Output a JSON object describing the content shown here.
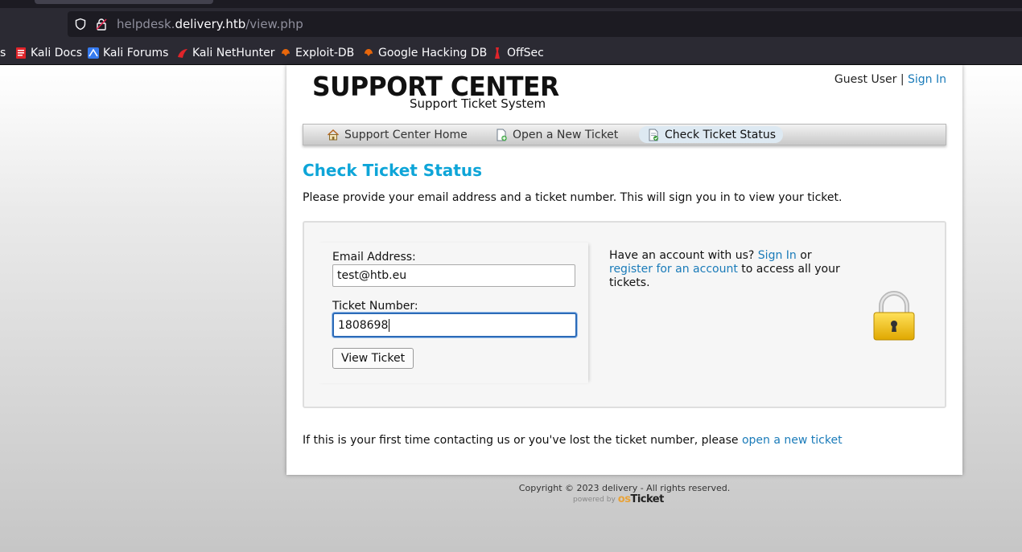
{
  "browser": {
    "url_host_prefix": "helpdesk.",
    "url_host": "delivery.htb",
    "url_path": "/view.php",
    "bookmarks": [
      {
        "label": "s",
        "icon": "folder-icon"
      },
      {
        "label": "Kali Docs",
        "icon": "kali-docs-icon"
      },
      {
        "label": "Kali Forums",
        "icon": "kali-forums-icon"
      },
      {
        "label": "Kali NetHunter",
        "icon": "kali-nethunter-icon"
      },
      {
        "label": "Exploit-DB",
        "icon": "exploit-db-icon"
      },
      {
        "label": "Google Hacking DB",
        "icon": "ghdb-icon"
      },
      {
        "label": "OffSec",
        "icon": "offsec-icon"
      }
    ]
  },
  "header": {
    "title": "SUPPORT CENTER",
    "subtitle": "Support Ticket System",
    "user_label": "Guest User",
    "separator": "|",
    "signin_label": "Sign In"
  },
  "nav": {
    "items": [
      {
        "label": "Support Center Home",
        "icon": "home-icon"
      },
      {
        "label": "Open a New Ticket",
        "icon": "new-ticket-icon"
      },
      {
        "label": "Check Ticket Status",
        "icon": "ticket-status-icon",
        "active": true
      }
    ]
  },
  "main": {
    "heading": "Check Ticket Status",
    "intro": "Please provide your email address and a ticket number. This will sign you in to view your ticket.",
    "form": {
      "email_label": "Email Address:",
      "email_value": "test@htb.eu",
      "ticket_label": "Ticket Number:",
      "ticket_value": "1808698",
      "submit_label": "View Ticket"
    },
    "account": {
      "prefix": "Have an account with us?",
      "signin_link": "Sign In",
      "or": "or",
      "register_link": "register for an account",
      "suffix": "to access all your tickets."
    },
    "footer_note": "If this is your first time contacting us or you've lost the ticket number, please",
    "footer_link": "open a new ticket"
  },
  "footer": {
    "copyright": "Copyright © 2023 delivery - All rights reserved.",
    "powered_by": "powered by",
    "brand_os": "os",
    "brand_ticket": "Ticket"
  },
  "colors": {
    "link": "#1a7bb9",
    "heading": "#0ea5d8",
    "focus_border": "#2c6bb8"
  }
}
